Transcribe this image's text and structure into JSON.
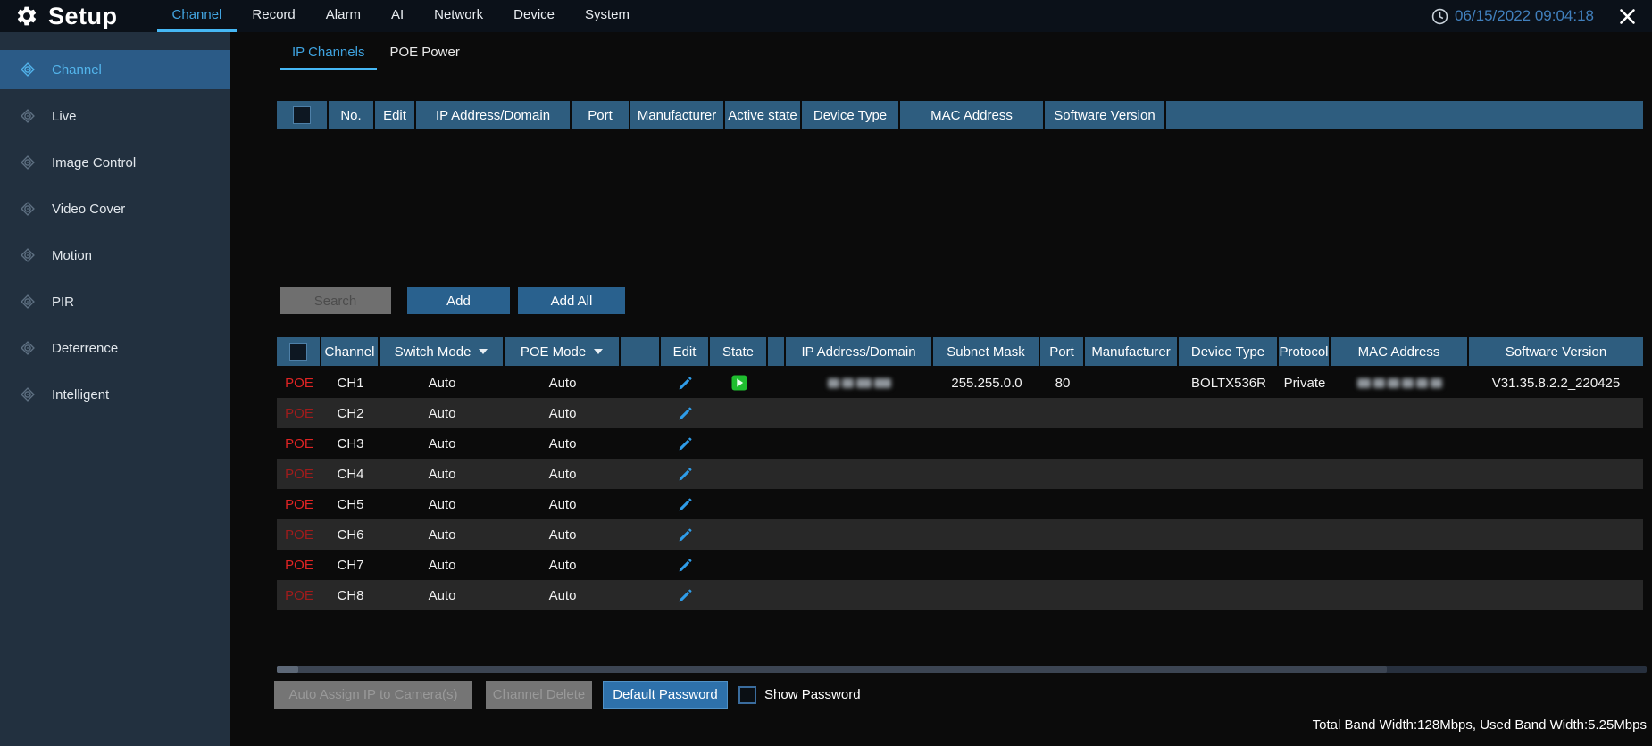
{
  "topbar": {
    "app_title": "Setup",
    "nav": [
      "Channel",
      "Record",
      "Alarm",
      "AI",
      "Network",
      "Device",
      "System"
    ],
    "active_nav": "Channel",
    "datetime": "06/15/2022 09:04:18"
  },
  "sidebar": {
    "items": [
      {
        "label": "Channel",
        "active": true
      },
      {
        "label": "Live",
        "active": false
      },
      {
        "label": "Image Control",
        "active": false
      },
      {
        "label": "Video Cover",
        "active": false
      },
      {
        "label": "Motion",
        "active": false
      },
      {
        "label": "PIR",
        "active": false
      },
      {
        "label": "Deterrence",
        "active": false
      },
      {
        "label": "Intelligent",
        "active": false
      }
    ]
  },
  "tabs": [
    {
      "label": "IP Channels",
      "active": true
    },
    {
      "label": "POE Power",
      "active": false
    }
  ],
  "discovered_table": {
    "headers": [
      "No.",
      "Edit",
      "IP Address/Domain",
      "Port",
      "Manufacturer",
      "Active state",
      "Device Type",
      "MAC Address",
      "Software Version"
    ],
    "rows": []
  },
  "actions": {
    "search": "Search",
    "add": "Add",
    "add_all": "Add All"
  },
  "channel_table": {
    "headers": [
      "Channel",
      "Switch Mode",
      "POE Mode",
      "",
      "Edit",
      "State",
      "",
      "IP Address/Domain",
      "Subnet Mask",
      "Port",
      "Manufacturer",
      "Device Type",
      "Protocol",
      "MAC Address",
      "Software Version"
    ],
    "rows": [
      {
        "poe_label": "POE",
        "channel": "CH1",
        "switch_mode": "Auto",
        "poe_mode": "Auto",
        "edit": true,
        "state": true,
        "ip_address_redacted": true,
        "subnet_mask": "255.255.0.0",
        "port": "80",
        "manufacturer": "",
        "device_type": "BOLTX536R",
        "protocol": "Private",
        "mac_address_redacted": true,
        "software_version": "V31.35.8.2.2_220425"
      },
      {
        "poe_label": "POE",
        "channel": "CH2",
        "switch_mode": "Auto",
        "poe_mode": "Auto",
        "edit": true
      },
      {
        "poe_label": "POE",
        "channel": "CH3",
        "switch_mode": "Auto",
        "poe_mode": "Auto",
        "edit": true
      },
      {
        "poe_label": "POE",
        "channel": "CH4",
        "switch_mode": "Auto",
        "poe_mode": "Auto",
        "edit": true
      },
      {
        "poe_label": "POE",
        "channel": "CH5",
        "switch_mode": "Auto",
        "poe_mode": "Auto",
        "edit": true
      },
      {
        "poe_label": "POE",
        "channel": "CH6",
        "switch_mode": "Auto",
        "poe_mode": "Auto",
        "edit": true
      },
      {
        "poe_label": "POE",
        "channel": "CH7",
        "switch_mode": "Auto",
        "poe_mode": "Auto",
        "edit": true
      },
      {
        "poe_label": "POE",
        "channel": "CH8",
        "switch_mode": "Auto",
        "poe_mode": "Auto",
        "edit": true
      }
    ]
  },
  "footer": {
    "auto_assign": "Auto Assign IP to Camera(s)",
    "channel_delete": "Channel Delete",
    "default_password": "Default Password",
    "show_password": "Show Password",
    "bandwidth": "Total Band Width:128Mbps, Used Band Width:5.25Mbps"
  },
  "colors": {
    "accent_blue": "#42a4e0",
    "table_header_blue": "#2e5d7f",
    "button_blue": "#29618e",
    "poe_red": "#e02424",
    "state_green": "#1fbe2f",
    "datetime_blue": "#4180bd"
  }
}
